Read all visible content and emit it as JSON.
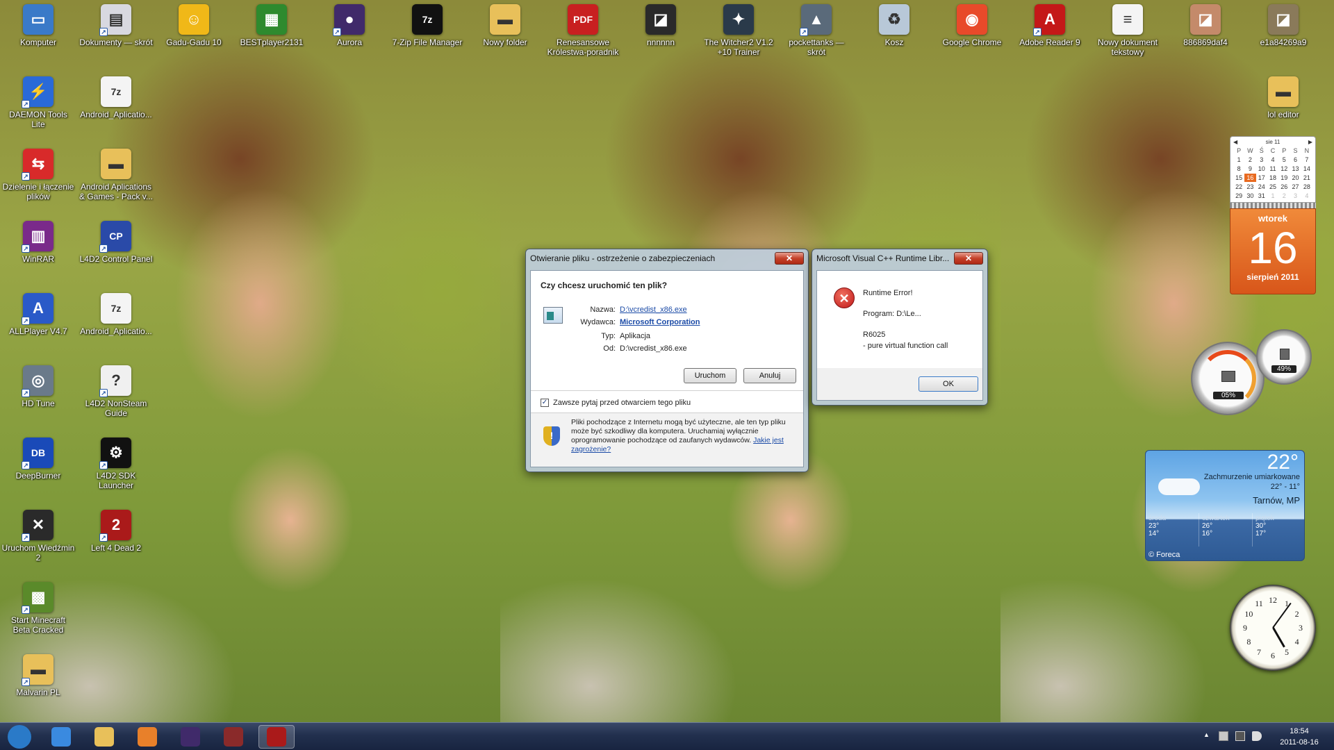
{
  "desktop": {
    "icons": [
      {
        "label": "Komputer",
        "icon": "computer-icon",
        "color": "#3a7ac8",
        "glyph": "▭",
        "shortcut": false
      },
      {
        "label": "Dokumenty — skrót",
        "icon": "documents-icon",
        "color": "#d8d8e0",
        "glyph": "▤",
        "shortcut": true
      },
      {
        "label": "Gadu-Gadu 10",
        "icon": "gadu-gadu-icon",
        "color": "#f0b818",
        "glyph": "☺",
        "shortcut": false
      },
      {
        "label": "BESTplayer2131",
        "icon": "bestplayer-icon",
        "color": "#2e8a2e",
        "glyph": "▦",
        "shortcut": false
      },
      {
        "label": "Aurora",
        "icon": "aurora-icon",
        "color": "#402a6a",
        "glyph": "●",
        "shortcut": true
      },
      {
        "label": "7-Zip File Manager",
        "icon": "7zip-icon",
        "color": "#111111",
        "glyph": "7z",
        "shortcut": false
      },
      {
        "label": "Nowy folder",
        "icon": "folder-icon",
        "color": "#e8c05a",
        "glyph": "▬",
        "shortcut": false
      },
      {
        "label": "Renesansowe Królestwa-poradnik",
        "icon": "pdf-icon",
        "color": "#c82020",
        "glyph": "PDF",
        "shortcut": false
      },
      {
        "label": "nnnnnn",
        "icon": "image-thumbnail-icon",
        "color": "#2a2a2a",
        "glyph": "◪",
        "shortcut": false
      },
      {
        "label": "The Witcher2 V1.2 +10 Trainer",
        "icon": "witcher-trainer-icon",
        "color": "#2a3a4a",
        "glyph": "✦",
        "shortcut": false
      },
      {
        "label": "pockettanks — skrót",
        "icon": "pockettanks-icon",
        "color": "#5a6a7a",
        "glyph": "▲",
        "shortcut": true
      },
      {
        "label": "Kosz",
        "icon": "recycle-bin-icon",
        "color": "#b8c8d8",
        "glyph": "♻",
        "shortcut": false
      },
      {
        "label": "Google Chrome",
        "icon": "chrome-icon",
        "color": "#e84a2a",
        "glyph": "◉",
        "shortcut": false
      },
      {
        "label": "Adobe Reader 9",
        "icon": "adobe-reader-icon",
        "color": "#c41818",
        "glyph": "A",
        "shortcut": true
      },
      {
        "label": "Nowy dokument tekstowy",
        "icon": "text-document-icon",
        "color": "#f4f4f4",
        "glyph": "≡",
        "shortcut": false
      },
      {
        "label": "886869daf4",
        "icon": "photo-icon",
        "color": "#c48a6a",
        "glyph": "◪",
        "shortcut": false
      },
      {
        "label": "e1a84269a9",
        "icon": "photo-icon",
        "color": "#8a7a5a",
        "glyph": "◪",
        "shortcut": false
      },
      {
        "label": "DAEMON Tools Lite",
        "icon": "daemon-tools-icon",
        "color": "#2a6ad8",
        "glyph": "⚡",
        "shortcut": true
      },
      {
        "label": "Android_Aplicatio...",
        "icon": "7zip-archive-icon",
        "color": "#f4f4f4",
        "glyph": "7z",
        "shortcut": false
      },
      {
        "label": "lol editor",
        "icon": "folder-icon",
        "color": "#e8c05a",
        "glyph": "▬",
        "shortcut": false
      },
      {
        "label": "Dzielenie i łączenie plików",
        "icon": "split-merge-icon",
        "color": "#d82a2a",
        "glyph": "⇆",
        "shortcut": true
      },
      {
        "label": "Android Aplications & Games - Pack v...",
        "icon": "folder-icon",
        "color": "#e8c05a",
        "glyph": "▬",
        "shortcut": false
      },
      {
        "label": "WinRAR",
        "icon": "winrar-icon",
        "color": "#7a2a8a",
        "glyph": "▥",
        "shortcut": true
      },
      {
        "label": "L4D2 Control Panel",
        "icon": "l4d2-control-panel-icon",
        "color": "#2a4aa8",
        "glyph": "CP",
        "shortcut": true
      },
      {
        "label": "ALLPlayer V4.7",
        "icon": "allplayer-icon",
        "color": "#2a5ac8",
        "glyph": "A",
        "shortcut": true
      },
      {
        "label": "Android_Aplicatio...",
        "icon": "7zip-archive-icon",
        "color": "#f4f4f4",
        "glyph": "7z",
        "shortcut": false
      },
      {
        "label": "HD Tune",
        "icon": "hd-tune-icon",
        "color": "#6a7a8a",
        "glyph": "◎",
        "shortcut": true
      },
      {
        "label": "L4D2 NonSteam Guide",
        "icon": "help-document-icon",
        "color": "#f0f0f0",
        "glyph": "?",
        "shortcut": true
      },
      {
        "label": "DeepBurner",
        "icon": "deepburner-icon",
        "color": "#1a4ab8",
        "glyph": "DB",
        "shortcut": true
      },
      {
        "label": "L4D2 SDK Launcher",
        "icon": "steam-icon",
        "color": "#111111",
        "glyph": "⚙",
        "shortcut": true
      },
      {
        "label": "Uruchom Wiedźmin 2",
        "icon": "witcher-icon",
        "color": "#2a2a2a",
        "glyph": "✕",
        "shortcut": true
      },
      {
        "label": "Left 4 Dead 2",
        "icon": "left4dead2-icon",
        "color": "#aa1a1a",
        "glyph": "2",
        "shortcut": true
      },
      {
        "label": "Start Minecraft Beta Cracked",
        "icon": "minecraft-icon",
        "color": "#5a8a2a",
        "glyph": "▩",
        "shortcut": true
      },
      {
        "label": "Malvarin PL",
        "icon": "folder-icon",
        "color": "#e8c05a",
        "glyph": "▬",
        "shortcut": true
      }
    ]
  },
  "security_dialog": {
    "title": "Otwieranie pliku - ostrzeżenie o zabezpieczeniach",
    "close": "✕",
    "question": "Czy chcesz uruchomić ten plik?",
    "name_label": "Nazwa:",
    "name_value": "D:\\vcredist_x86.exe",
    "publisher_label": "Wydawca:",
    "publisher_value": "Microsoft Corporation",
    "type_label": "Typ:",
    "type_value": "Aplikacja",
    "from_label": "Od:",
    "from_value": "D:\\vcredist_x86.exe",
    "run_button": "Uruchom",
    "cancel_button": "Anuluj",
    "always_ask": "Zawsze pytaj przed otwarciem tego pliku",
    "warning_text": "Pliki pochodzące z Internetu mogą być użyteczne, ale ten typ pliku może być szkodliwy dla komputera. Uruchamiaj wyłącznie oprogramowanie pochodzące od zaufanych wydawców.",
    "risk_link": "Jakie jest zagrożenie?"
  },
  "error_dialog": {
    "title": "Microsoft Visual C++ Runtime Libr...",
    "close": "✕",
    "line1": "Runtime Error!",
    "line2": "Program: D:\\Le...",
    "line3": "R6025",
    "line4": "- pure virtual function call",
    "ok_button": "OK"
  },
  "calendar": {
    "month": "sie 11",
    "prev": "◀",
    "next": "▶",
    "weekdays": [
      "P",
      "W",
      "Ś",
      "C",
      "P",
      "S",
      "N"
    ],
    "days": [
      [
        "1",
        "2",
        "3",
        "4",
        "5",
        "6",
        "7"
      ],
      [
        "8",
        "9",
        "10",
        "11",
        "12",
        "13",
        "14"
      ],
      [
        "15",
        "16",
        "17",
        "18",
        "19",
        "20",
        "21"
      ],
      [
        "22",
        "23",
        "24",
        "25",
        "26",
        "27",
        "28"
      ],
      [
        "29",
        "30",
        "31",
        "1",
        "2",
        "3",
        "4"
      ]
    ],
    "today": "16",
    "weekday_name": "wtorek",
    "day_big": "16",
    "month_year": "sierpień 2011",
    "accent": "#e86a20"
  },
  "meter": {
    "cpu": "05%",
    "memory": "49%"
  },
  "weather": {
    "temp": "22°",
    "condition": "Zachmurzenie umiarkowane",
    "range": "22° - 11°",
    "location": "Tarnów, MP",
    "forecast": [
      {
        "day": "środa",
        "high": "23°",
        "low": "14°"
      },
      {
        "day": "czwartek",
        "high": "26°",
        "low": "16°"
      },
      {
        "day": "piątek",
        "high": "30°",
        "low": "17°"
      }
    ],
    "credit": "© Foreca"
  },
  "clock": {
    "numerals": [
      "12",
      "1",
      "2",
      "3",
      "4",
      "5",
      "6",
      "7",
      "8",
      "9",
      "10",
      "11"
    ]
  },
  "taskbar": {
    "apps": [
      {
        "icon": "start-orb-icon",
        "color": "#2a7ac8"
      },
      {
        "icon": "internet-explorer-icon",
        "color": "#3a8ae0"
      },
      {
        "icon": "file-explorer-icon",
        "color": "#e8c05a"
      },
      {
        "icon": "media-player-icon",
        "color": "#e8802a"
      },
      {
        "icon": "aurora-icon",
        "color": "#402a6a"
      },
      {
        "icon": "game-window-icon",
        "color": "#8a2a2a"
      },
      {
        "icon": "left4dead2-icon",
        "color": "#aa1a1a"
      }
    ],
    "time": "18:54",
    "date": "2011-08-16",
    "tray_chevron": "▲"
  }
}
